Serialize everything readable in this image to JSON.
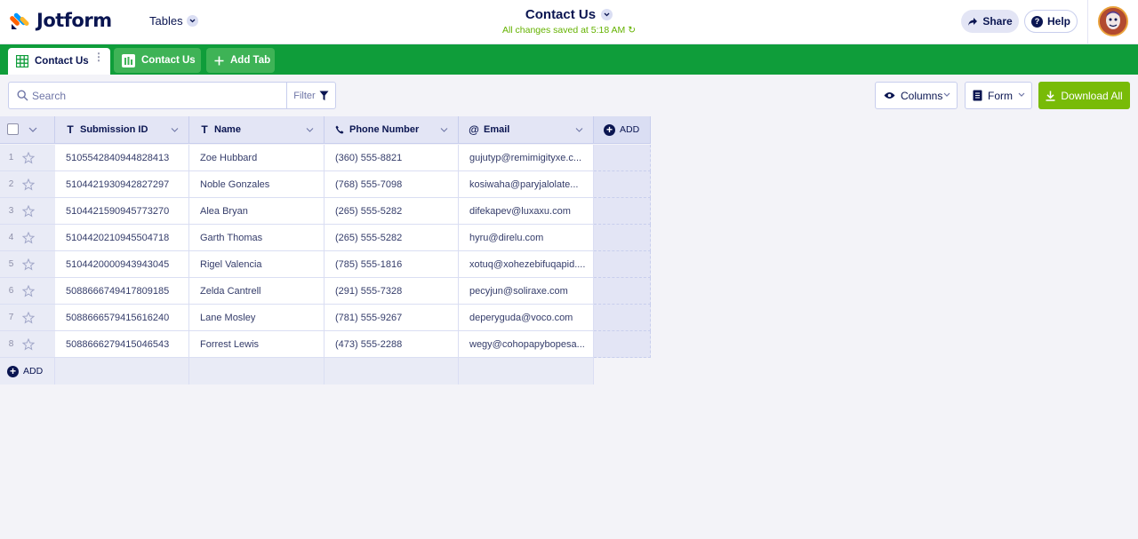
{
  "app": {
    "brand": "Jotform",
    "menu_label": "Tables"
  },
  "document": {
    "title": "Contact Us",
    "status": "All changes saved at 5:18 AM"
  },
  "header_actions": {
    "share": "Share",
    "help": "Help"
  },
  "tabs": [
    {
      "label": "Contact Us",
      "icon": "grid-icon",
      "active": true
    },
    {
      "label": "Contact Us",
      "icon": "report-icon",
      "active": false
    }
  ],
  "add_tab_label": "Add Tab",
  "toolbar": {
    "search_placeholder": "Search",
    "filter_label": "Filter",
    "columns_label": "Columns",
    "form_label": "Form",
    "download_label": "Download All"
  },
  "columns": [
    {
      "label": "Submission ID",
      "type": "text"
    },
    {
      "label": "Name",
      "type": "text"
    },
    {
      "label": "Phone Number",
      "type": "phone"
    },
    {
      "label": "Email",
      "type": "email"
    }
  ],
  "add_column_label": "ADD",
  "add_row_label": "ADD",
  "rows": [
    {
      "num": "1",
      "id": "5105542840944828413",
      "name": "Zoe Hubbard",
      "phone": "(360) 555-8821",
      "email": "gujutyp@remimigityxe.c..."
    },
    {
      "num": "2",
      "id": "5104421930942827297",
      "name": "Noble Gonzales",
      "phone": "(768) 555-7098",
      "email": "kosiwaha@paryjalolate..."
    },
    {
      "num": "3",
      "id": "5104421590945773270",
      "name": "Alea Bryan",
      "phone": "(265) 555-5282",
      "email": "difekapev@luxaxu.com"
    },
    {
      "num": "4",
      "id": "5104420210945504718",
      "name": "Garth Thomas",
      "phone": "(265) 555-5282",
      "email": "hyru@direlu.com"
    },
    {
      "num": "5",
      "id": "5104420000943943045",
      "name": "Rigel Valencia",
      "phone": "(785) 555-1816",
      "email": "xotuq@xohezebifuqapid...."
    },
    {
      "num": "6",
      "id": "5088666749417809185",
      "name": "Zelda Cantrell",
      "phone": "(291) 555-7328",
      "email": "pecyjun@soliraxe.com"
    },
    {
      "num": "7",
      "id": "5088666579415616240",
      "name": "Lane Mosley",
      "phone": "(781) 555-9267",
      "email": "deperyguda@voco.com"
    },
    {
      "num": "8",
      "id": "5088666279415046543",
      "name": "Forrest Lewis",
      "phone": "(473) 555-2288",
      "email": "wegy@cohopapybopesa..."
    }
  ],
  "colors": {
    "brand_green": "#0f9d3a",
    "download_green": "#78bb07",
    "navy": "#0a1551",
    "saved_green": "#64b200"
  }
}
